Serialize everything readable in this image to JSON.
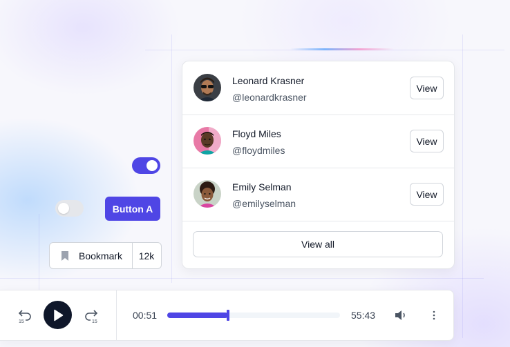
{
  "people": [
    {
      "name": "Leonard Krasner",
      "handle": "@leonardkrasner",
      "action": "View"
    },
    {
      "name": "Floyd Miles",
      "handle": "@floydmiles",
      "action": "View"
    },
    {
      "name": "Emily Selman",
      "handle": "@emilyselman",
      "action": "View"
    }
  ],
  "view_all_label": "View all",
  "toggles": {
    "first_on": true,
    "second_on": false
  },
  "button_a_label": "Button A",
  "bookmark": {
    "label": "Bookmark",
    "count": "12k"
  },
  "player": {
    "current_time": "00:51",
    "total_time": "55:43",
    "progress": 0.35,
    "skip_back_seconds": "15",
    "skip_forward_seconds": "15"
  },
  "colors": {
    "accent": "#4f46e5",
    "play_button": "#0f172a"
  },
  "icons": [
    "bookmark-icon",
    "skip-back-15-icon",
    "play-icon",
    "skip-forward-15-icon",
    "volume-icon",
    "more-vertical-icon"
  ]
}
